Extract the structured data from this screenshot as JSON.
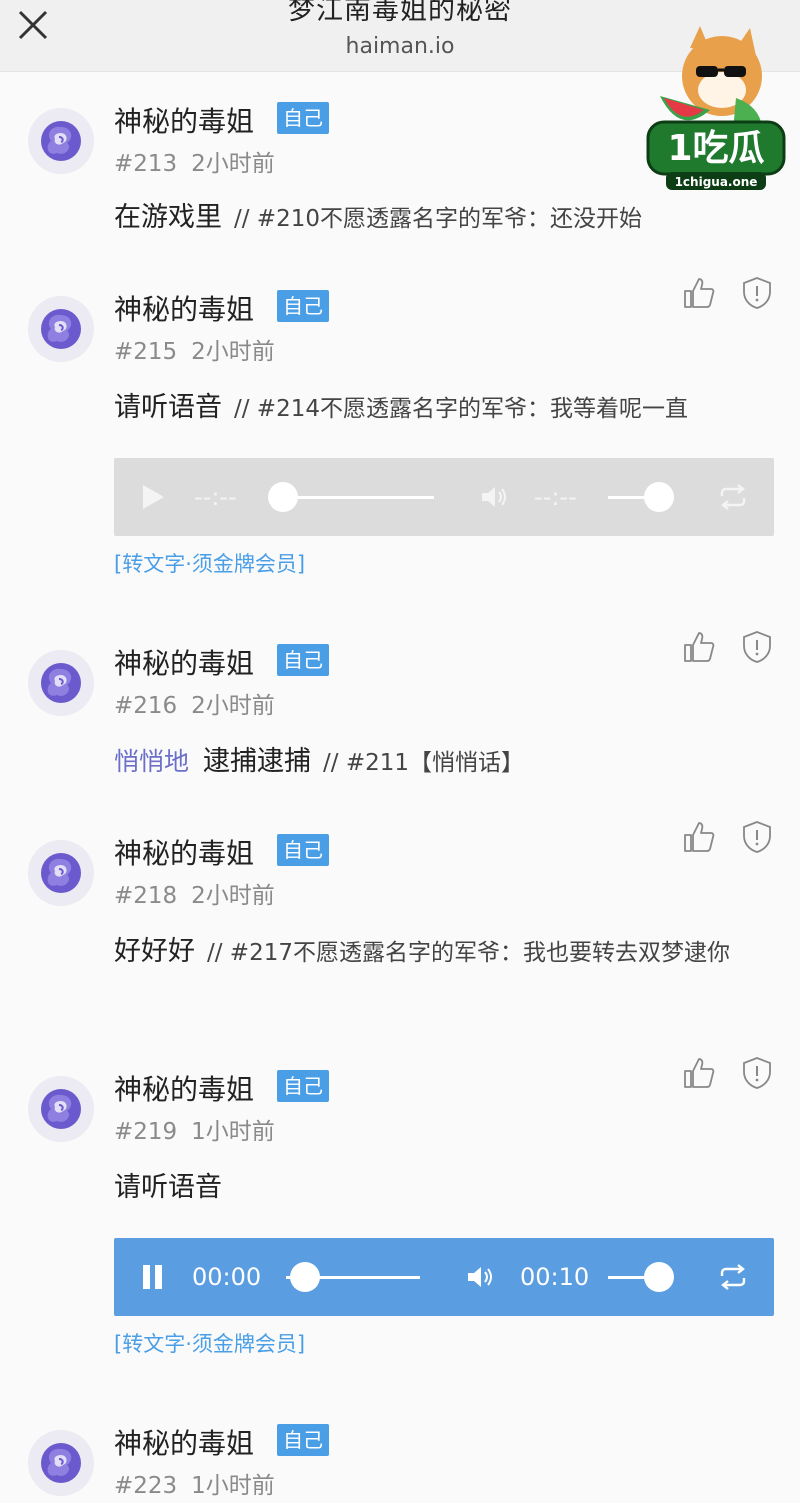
{
  "header": {
    "title": "梦江南毒姐的秘密",
    "domain": "haiman.io"
  },
  "watermark": {
    "brand": "1吃瓜",
    "site": "1chigua.one"
  },
  "colors": {
    "badge": "#4a9ee6",
    "link": "#4a9ee6",
    "whisper": "#6b6fc9",
    "audio_active": "#5a9de0",
    "audio_idle": "#dcdcdc"
  },
  "posts": [
    {
      "author": "神秘的毒姐",
      "badge": "自己",
      "floor": "#213",
      "time": "2小时前",
      "text": "在游戏里",
      "quote": "// #210不愿透露名字的军爷：还没开始"
    },
    {
      "author": "神秘的毒姐",
      "badge": "自己",
      "floor": "#215",
      "time": "2小时前",
      "text": "请听语音",
      "quote": "// #214不愿透露名字的军爷：我等着呢一直",
      "audio": {
        "current": "--:--",
        "duration": "--:--",
        "state": "idle",
        "progress": 0,
        "volume": 0.9
      },
      "convert": "[转文字·须金牌会员]"
    },
    {
      "author": "神秘的毒姐",
      "badge": "自己",
      "floor": "#216",
      "time": "2小时前",
      "whisper": "悄悄地",
      "text": "逮捕逮捕",
      "quote": "// #211【悄悄话】"
    },
    {
      "author": "神秘的毒姐",
      "badge": "自己",
      "floor": "#218",
      "time": "2小时前",
      "text": "好好好",
      "quote": "// #217不愿透露名字的军爷：我也要转去双梦逮你"
    },
    {
      "author": "神秘的毒姐",
      "badge": "自己",
      "floor": "#219",
      "time": "1小时前",
      "text": "请听语音",
      "audio": {
        "current": "00:00",
        "duration": "00:10",
        "state": "playing",
        "progress": 0,
        "volume": 0.9
      },
      "convert": "[转文字·须金牌会员]"
    },
    {
      "author": "神秘的毒姐",
      "badge": "自己",
      "floor": "#223",
      "time": "1小时前"
    }
  ]
}
